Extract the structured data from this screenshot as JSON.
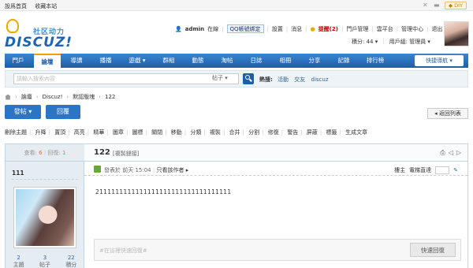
{
  "topbar": {
    "set_home": "設爲首頁",
    "favorite": "收藏本站",
    "diy": "DIY"
  },
  "logo": {
    "cn": "社区动力",
    "en": "DISCUZ!"
  },
  "user": {
    "name": "admin",
    "online": "在線",
    "qq_bind": "QQ帳號綁定",
    "links": [
      "設置",
      "消息",
      "提醒(2)",
      "門戶管理",
      "雲平台",
      "管理中心",
      "退出"
    ],
    "points": "積分: 44",
    "group": "用戶組: 管理員"
  },
  "nav": {
    "items": [
      "門戶",
      "論壇",
      "導讀",
      "播播",
      "遊戲",
      "群組",
      "動態",
      "淘帖",
      "日誌",
      "相冊",
      "分享",
      "記錄",
      "排行榜"
    ],
    "active_index": 1,
    "quick": "快捷導航"
  },
  "search": {
    "placeholder": "請輸入搜索內容",
    "scope": "帖子",
    "hot_label": "熱搜:",
    "hot": [
      "活動",
      "交友",
      "discuz"
    ]
  },
  "breadcrumb": [
    "論壇",
    "Discuz!",
    "默認版塊",
    "122"
  ],
  "actions": {
    "post": "發帖",
    "reply": "回覆",
    "back": "返回列表"
  },
  "modbar": [
    "刪除主題",
    "升降",
    "置頂",
    "高亮",
    "精華",
    "圖章",
    "圖標",
    "關閉",
    "移動",
    "分類",
    "複製",
    "合并",
    "分割",
    "修復",
    "警告",
    "屏蔽",
    "標籤",
    "生成文章"
  ],
  "post": {
    "views_label": "查看:",
    "views": "6",
    "replies_label": "回復:",
    "replies": "1",
    "title": "122",
    "copy_link": "[複製鏈接]",
    "author": "111",
    "meta": "發表於 前天 15:04",
    "only_author": "只看該作者",
    "floor": "樓主",
    "goto": "電梯直達",
    "content": "2111111111111111111111111111111111",
    "stats": [
      {
        "value": "2",
        "label": "主題"
      },
      {
        "value": "3",
        "label": "帖子"
      },
      {
        "value": "22",
        "label": "積分"
      }
    ],
    "fast_reply_placeholder": "#在這裡快速回復#",
    "fast_reply_button": "快速回復"
  }
}
